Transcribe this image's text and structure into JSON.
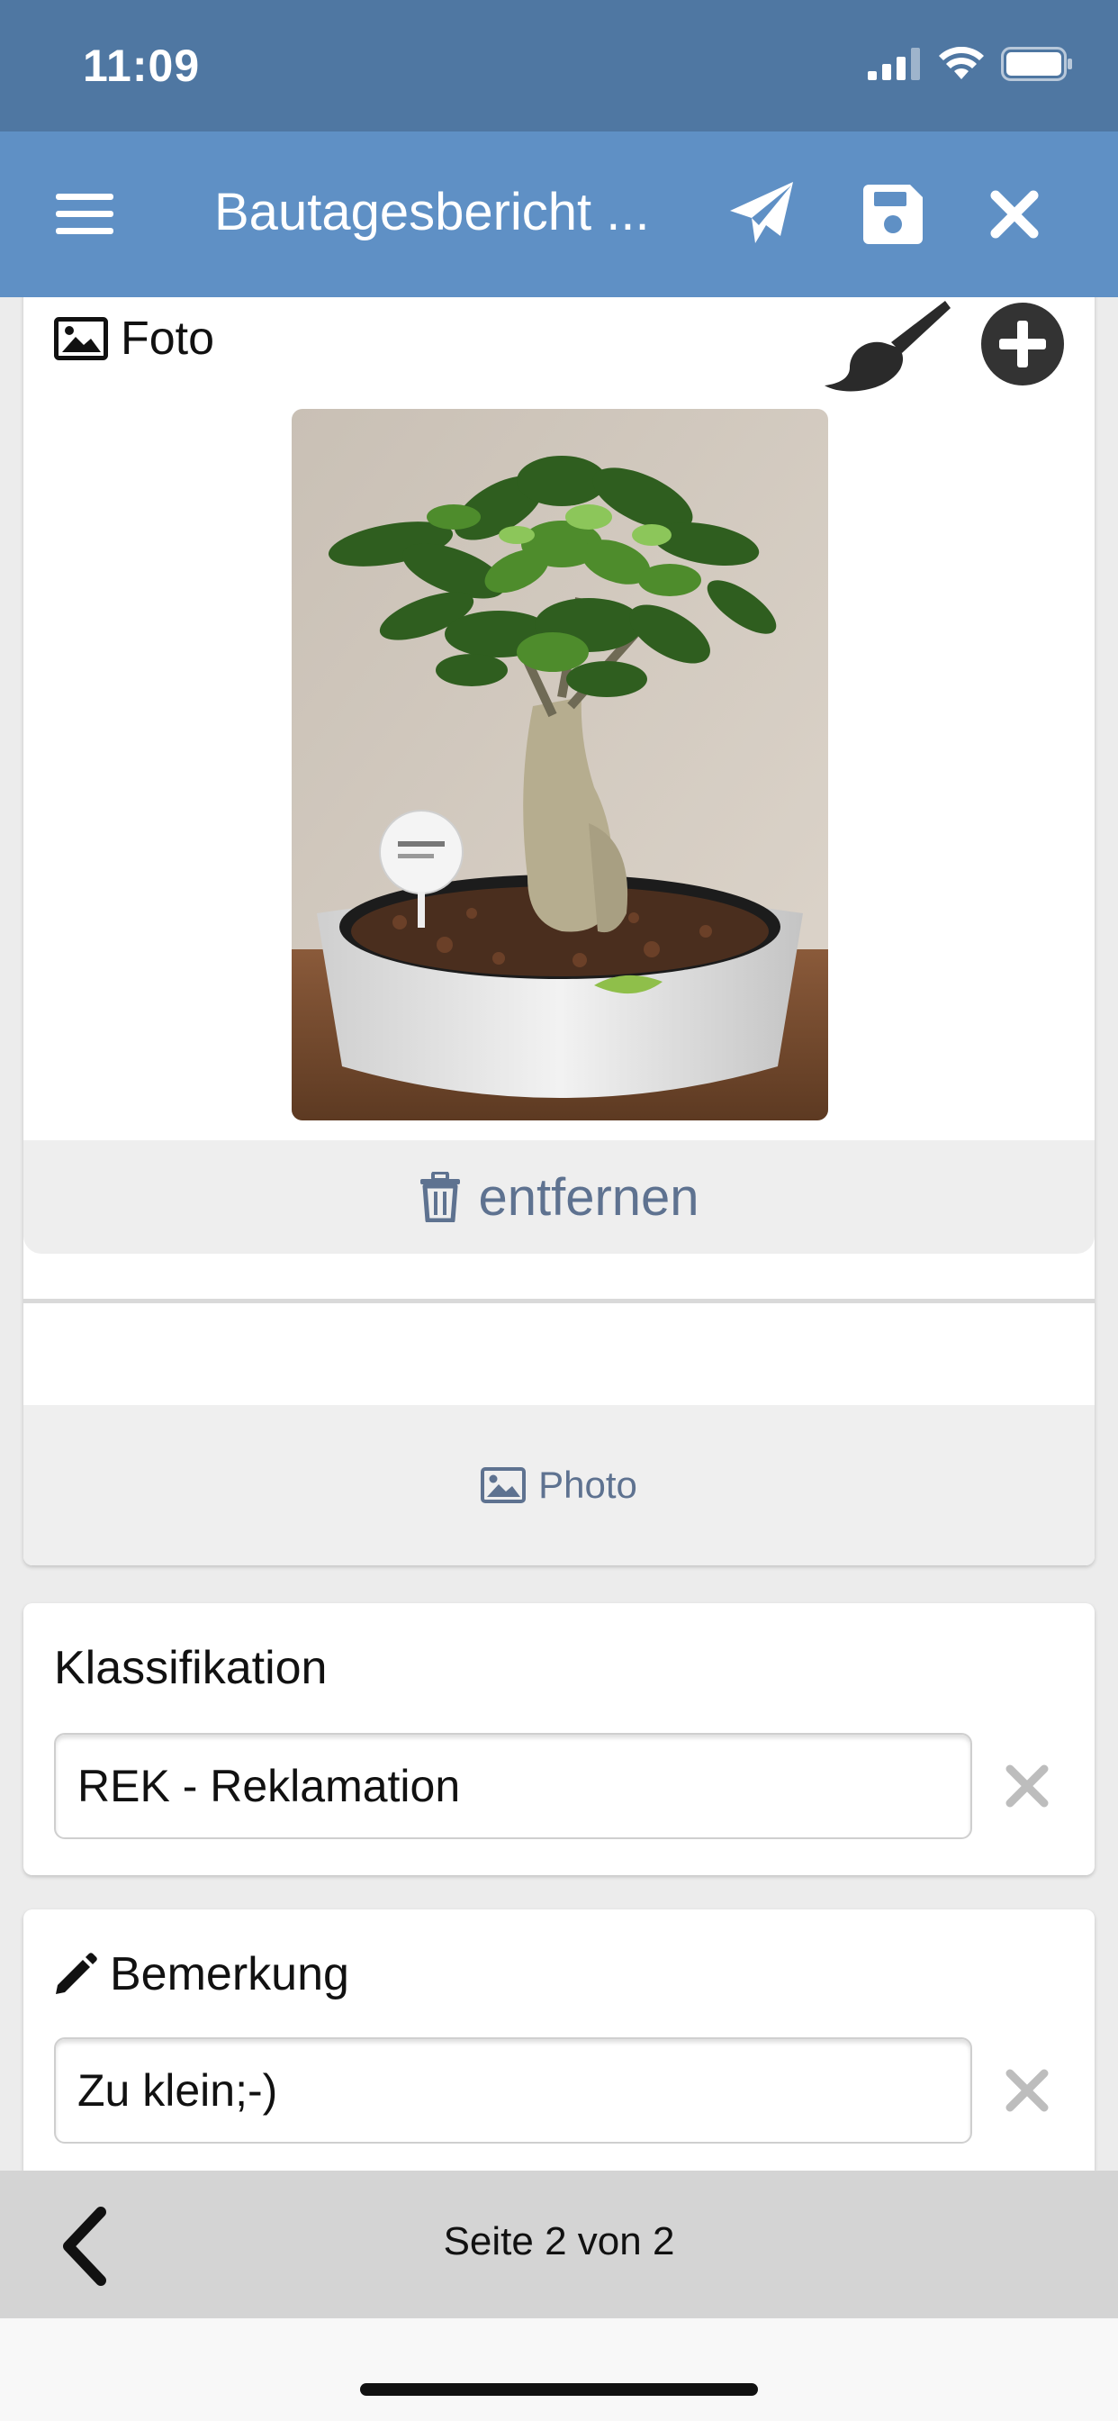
{
  "status_bar": {
    "time": "11:09"
  },
  "nav": {
    "title": "Bautagesbericht ...",
    "icons": [
      "menu-icon",
      "send-icon",
      "save-icon",
      "close-icon"
    ]
  },
  "photo_section": {
    "label": "Foto",
    "remove_label": "entfernen",
    "photo_button_label": "Photo",
    "image_description_icons": [
      "image-icon",
      "brush-icon",
      "plus-circle-icon",
      "trash-icon"
    ]
  },
  "classification": {
    "label": "Klassifikation",
    "value": "REK - Reklamation"
  },
  "remark": {
    "label": "Bemerkung",
    "value": "Zu klein;-)"
  },
  "footer": {
    "page_label": "Seite 2 von 2"
  },
  "colors": {
    "status_bar": "#4f77a2",
    "nav_bar": "#5f90c5",
    "muted_accent": "#5e7290",
    "footer_bar": "#d4d4d4"
  }
}
